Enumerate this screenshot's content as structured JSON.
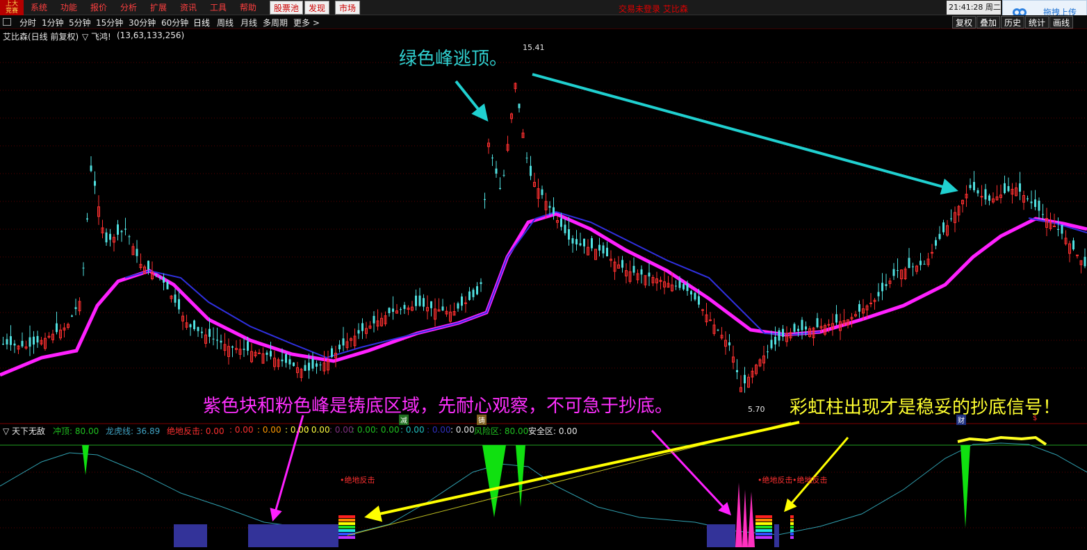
{
  "menu": {
    "logo": "上大\n竞赛",
    "items": [
      "系统",
      "功能",
      "报价",
      "分析",
      "扩展",
      "资讯",
      "工具",
      "帮助"
    ],
    "buttons": [
      "股票池",
      "发现",
      "市场"
    ],
    "status_title": "交易未登录 艾比森",
    "clock": "21:41:28 周二",
    "upload_label": "拖拽上传"
  },
  "periods": [
    "分时",
    "1分钟",
    "5分钟",
    "15分钟",
    "30分钟",
    "60分钟",
    "日线",
    "周线",
    "月线",
    "多周期",
    "更多 >"
  ],
  "active_period": "日线",
  "right_buttons": [
    "复权",
    "叠加",
    "历史",
    "统计",
    "画线"
  ],
  "stock": {
    "title": "艾比森(日线 前复权)",
    "marker": "▽ 飞鸿!",
    "params": "(13,63,133,256)",
    "high_label": "15.41",
    "low_label": "5.70"
  },
  "annotations": {
    "green_peak": "绿色峰逃顶。",
    "purple_block": "紫色块和粉色峰是铸底区域，先耐心观察，不可急于抄底。",
    "rainbow": "彩虹柱出现才是稳妥的抄底信号！"
  },
  "tags": {
    "jian": "减",
    "zhu": "铸",
    "cai": "财",
    "s": "$"
  },
  "indicator": {
    "name": "▽ 天下无敌",
    "items": [
      {
        "label": "冲顶: 80.00",
        "color": "#20c020"
      },
      {
        "label": "龙虎线: 36.89",
        "color": "#40a0c0"
      },
      {
        "label": "绝地反击: 0.00",
        "color": "#ff3030"
      },
      {
        "label": ": 0.00",
        "color": "#ff3030"
      },
      {
        "label": ": 0.00",
        "color": "#ff9900"
      },
      {
        "label": ": 0.00",
        "color": "#ffff40"
      },
      {
        "label": ": 0.00",
        "color": "#ffff40"
      },
      {
        "label": ": 0.00",
        "color": "#803080"
      },
      {
        "label": ": 0.00",
        "color": "#20c020"
      },
      {
        "label": ": 0.00",
        "color": "#20c020"
      },
      {
        "label": ": 0.00",
        "color": "#20c0c0"
      },
      {
        "label": ": 0.00",
        "color": "#3030c0"
      },
      {
        "label": ": 0.00",
        "color": "#e8e8e8"
      },
      {
        "label": "风险区: 80.00",
        "color": "#20c020"
      },
      {
        "label": "安全区: 0.00",
        "color": "#e8e8e8"
      }
    ],
    "signal_label_1": "•绝地反击",
    "signal_label_2": "•绝地反击",
    "signal_label_3": "•绝地反击"
  },
  "colors": {
    "up": "#ff3030",
    "down": "#50e0e0",
    "ma_magenta": "#ff20ff",
    "ma_blue": "#3030e0",
    "arrow_cyan": "#20d0d0",
    "arrow_magenta": "#ff20ff",
    "arrow_yellow": "#ffff00",
    "purple_block": "#333399",
    "green_peak": "#10e010"
  }
}
